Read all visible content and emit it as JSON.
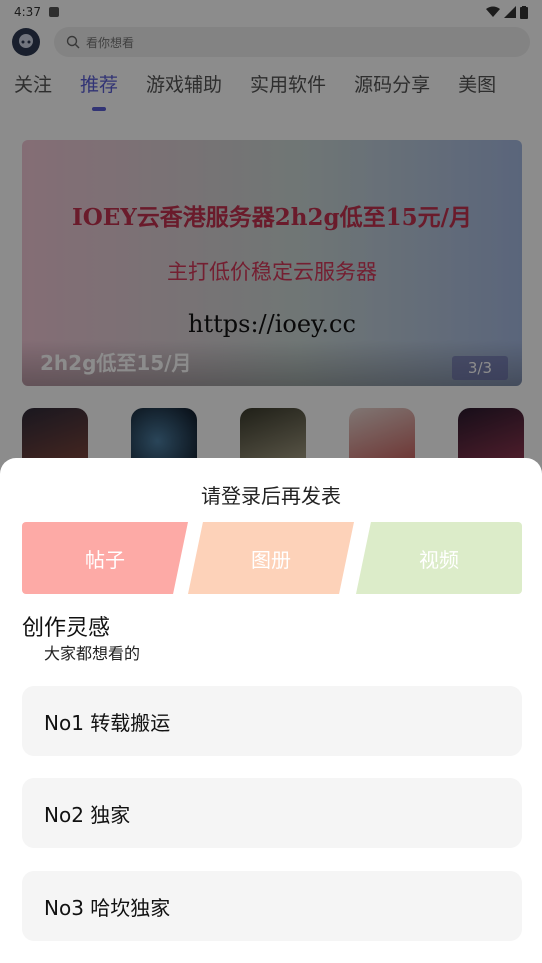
{
  "status_bar": {
    "time": "4:37"
  },
  "search": {
    "placeholder": "看你想看"
  },
  "tabs": [
    "关注",
    "推荐",
    "游戏辅助",
    "实用软件",
    "源码分享",
    "美图"
  ],
  "active_tab": "推荐",
  "banner": {
    "line1": "IOEY云香港服务器2h2g低至15元/月",
    "line2": "主打低价稳定云服务器",
    "line3": "https://ioey.cc",
    "caption": "2h2g低至15/月",
    "counter": "3/3"
  },
  "apps": [
    {
      "icon": "app-icon-reading-girl",
      "color": "#6b3b3b"
    },
    {
      "icon": "app-icon-night-sky",
      "color": "#1f3346"
    },
    {
      "icon": "app-icon-forest",
      "color": "#6f6a52"
    },
    {
      "icon": "app-icon-red-anime",
      "color": "#c4504d"
    },
    {
      "icon": "app-icon-dark-figure",
      "color": "#4b2345"
    }
  ],
  "sheet": {
    "title": "请登录后再发表",
    "types": {
      "post": "帖子",
      "album": "图册",
      "video": "视频"
    },
    "section_title": "创作灵感",
    "section_sub": "大家都想看的",
    "ideas": [
      "No1 转载搬运",
      "No2 独家",
      "No3 哈坎独家"
    ]
  },
  "colors": {
    "accent": "#5b5fd6",
    "post": "#fdaaa6",
    "album": "#fdd2b9",
    "video": "#dcecc9"
  }
}
